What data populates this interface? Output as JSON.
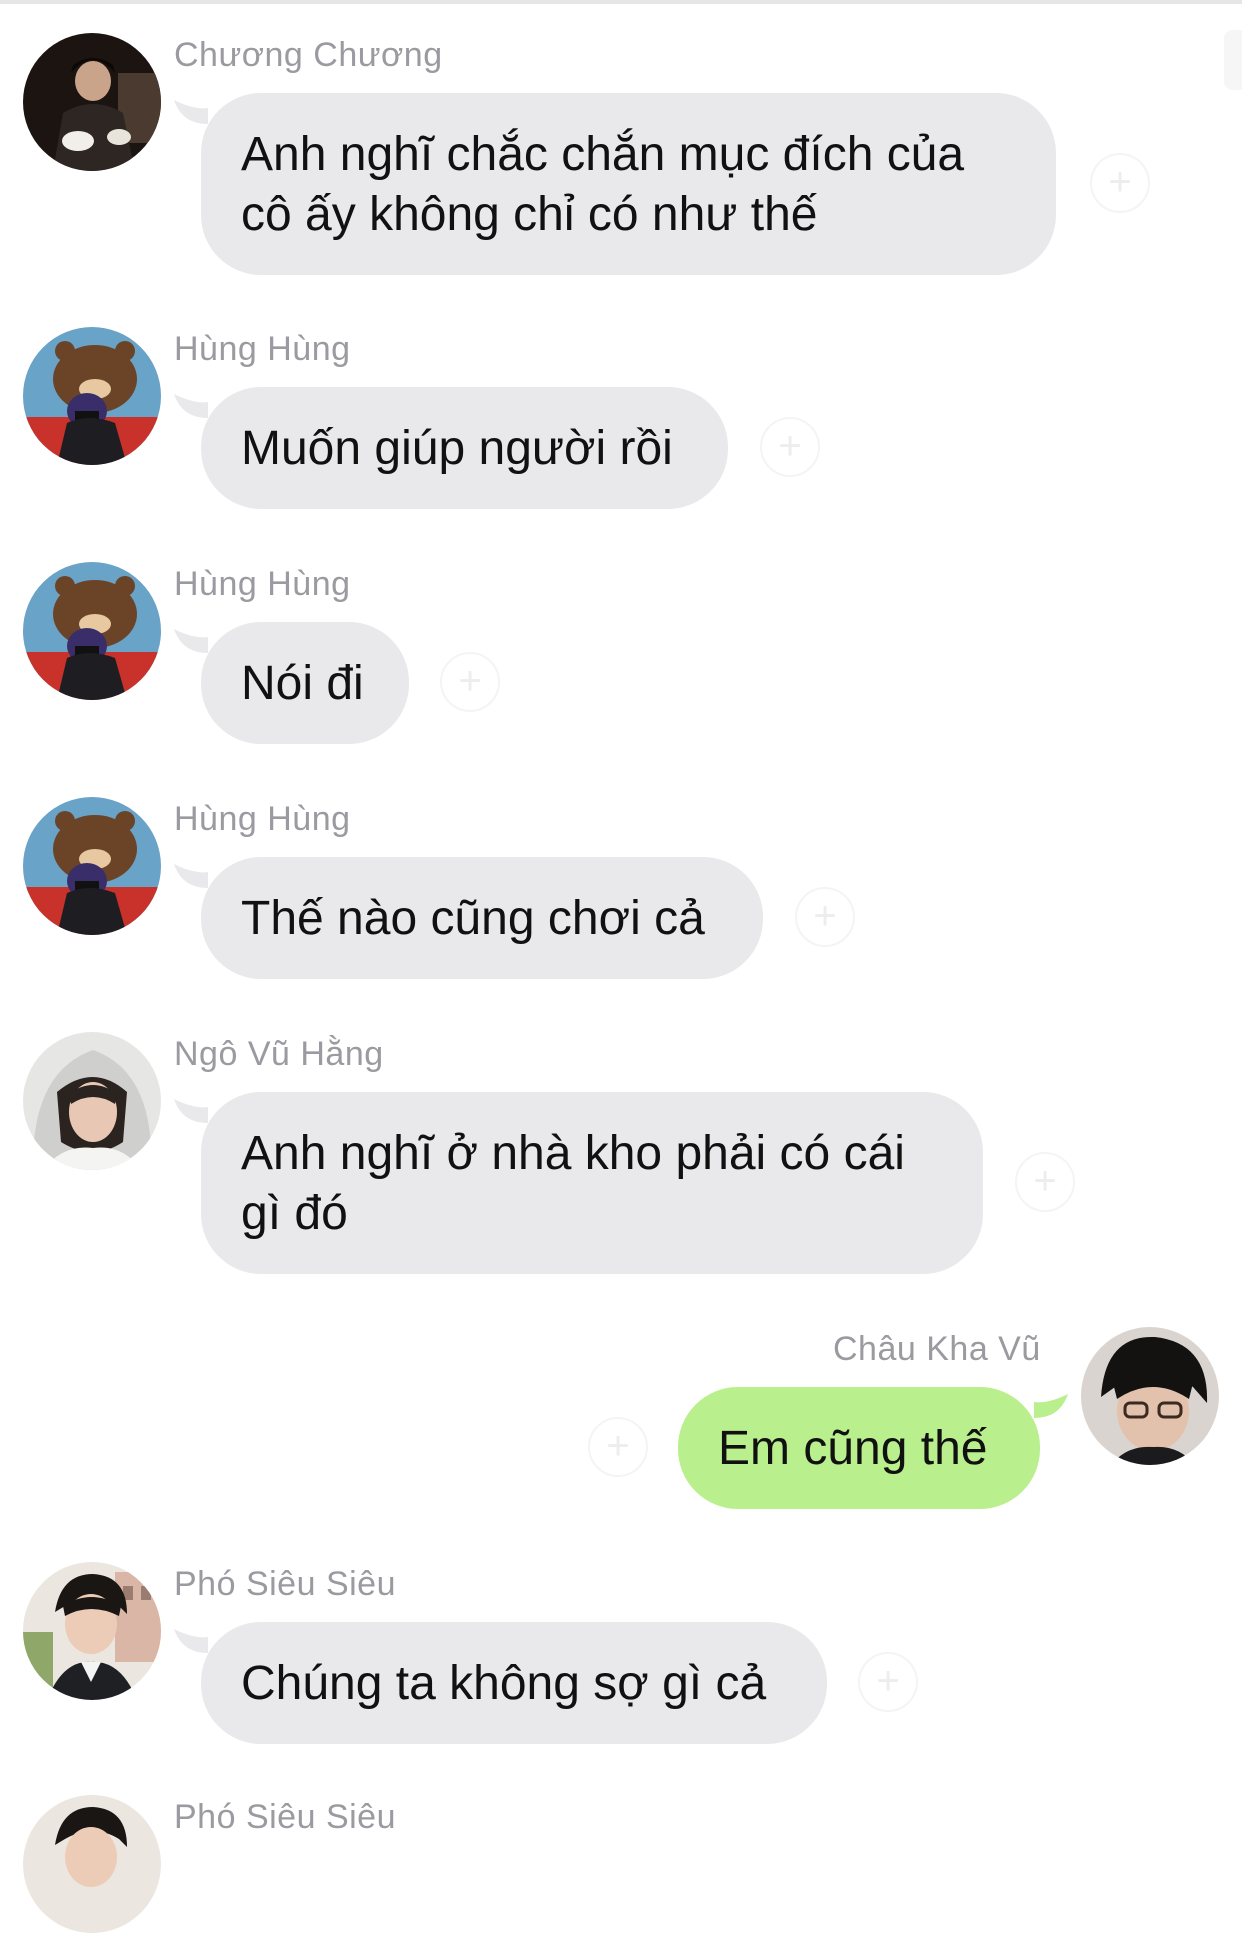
{
  "colors": {
    "incoming_bubble": "#e9e9eb",
    "outgoing_bubble": "#b9ef8c",
    "sender_name": "#9a9aa0",
    "text": "#111111"
  },
  "messages": [
    {
      "sender": "Chương Chương",
      "lines": [
        "Anh nghĩ chắc chắn mục đích của",
        "cô ấy không chỉ có như thế"
      ],
      "outgoing": false
    },
    {
      "sender": "Hùng Hùng",
      "lines": [
        "Muốn giúp người rồi"
      ],
      "outgoing": false
    },
    {
      "sender": "Hùng Hùng",
      "lines": [
        "Nói đi"
      ],
      "outgoing": false
    },
    {
      "sender": "Hùng Hùng",
      "lines": [
        "Thế nào cũng chơi cả"
      ],
      "outgoing": false
    },
    {
      "sender": "Ngô Vũ Hằng",
      "lines": [
        "Anh nghĩ ở nhà kho phải có cái",
        "gì đó"
      ],
      "outgoing": false
    },
    {
      "sender": "Châu Kha Vũ",
      "lines": [
        "Em cũng thế"
      ],
      "outgoing": true
    },
    {
      "sender": "Phó Siêu Siêu",
      "lines": [
        "Chúng ta không sợ gì cả"
      ],
      "outgoing": false
    },
    {
      "sender": "Phó Siêu Siêu",
      "lines": [],
      "outgoing": false
    }
  ],
  "icons": {
    "reaction": "add-reaction-icon"
  }
}
